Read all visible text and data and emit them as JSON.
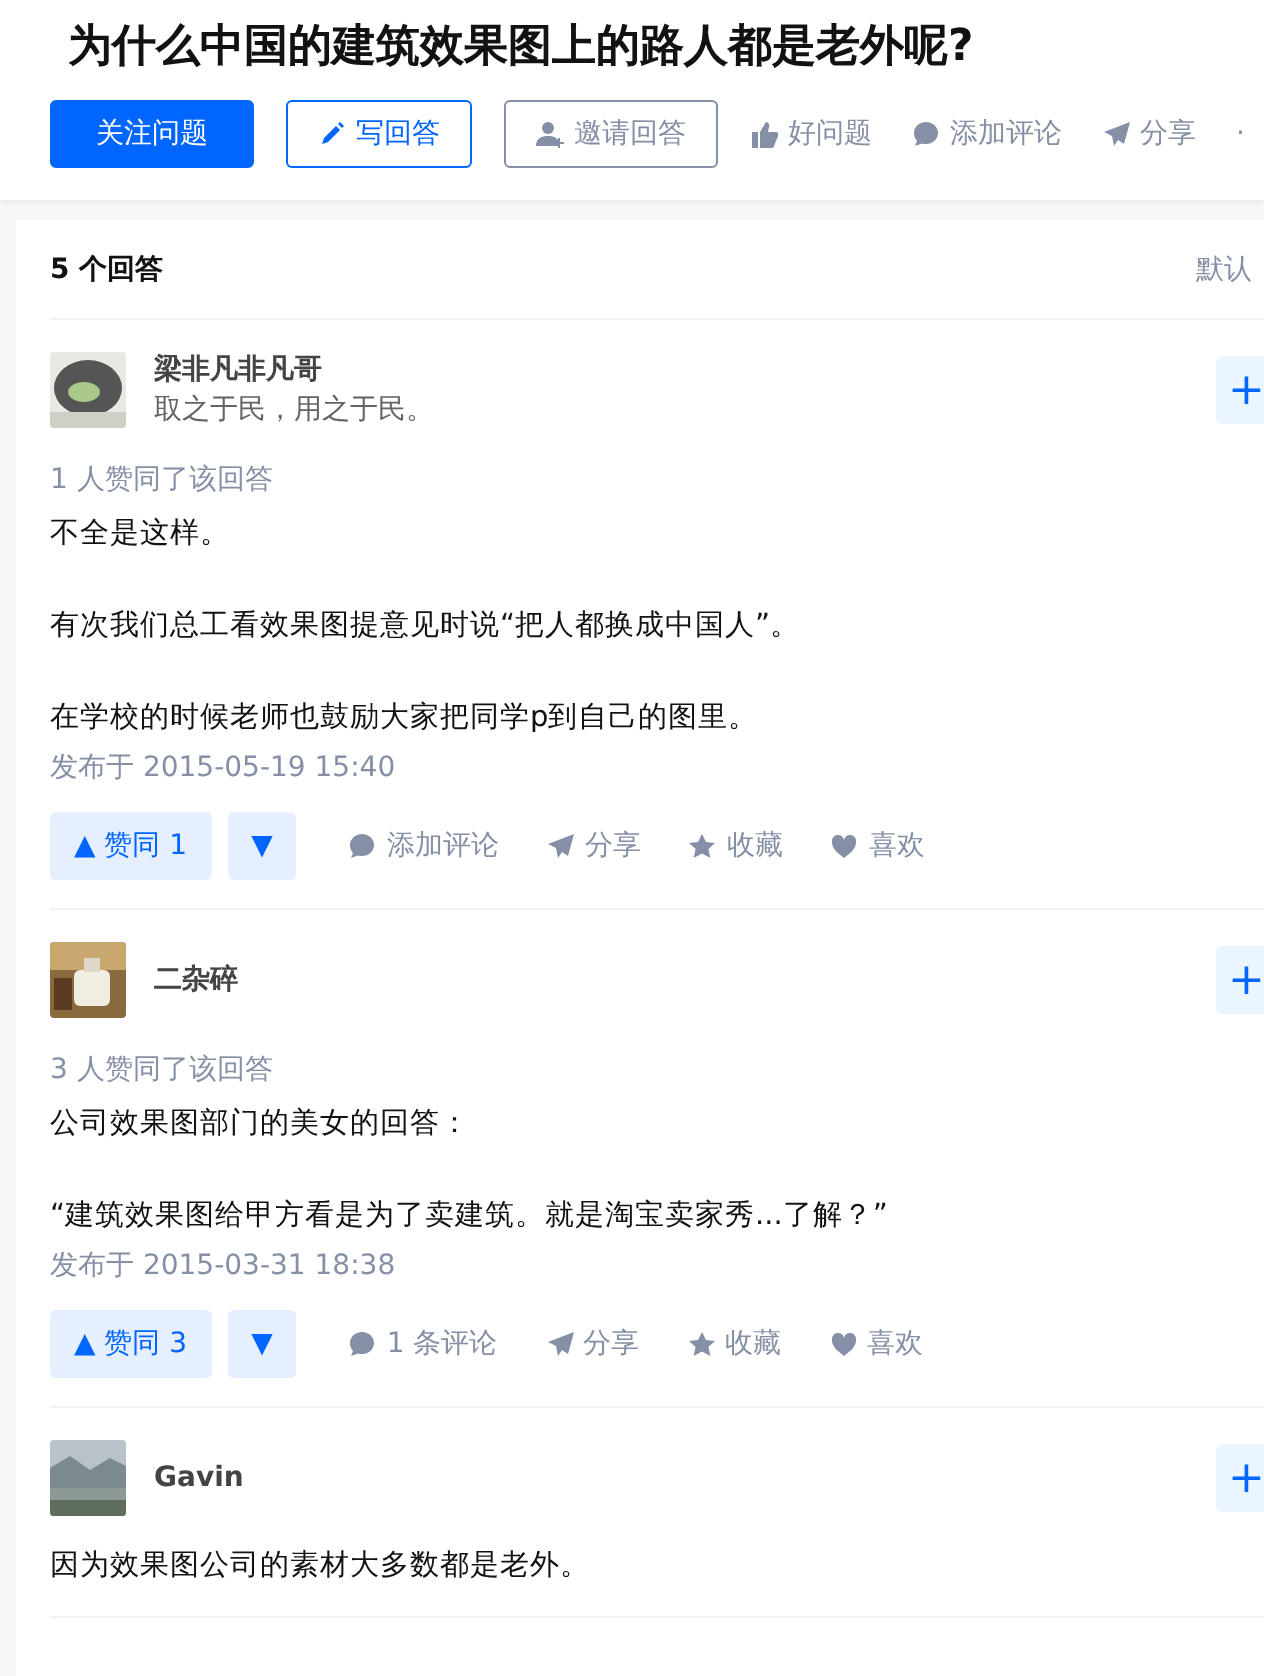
{
  "question": {
    "title": "为什么中国的建筑效果图上的路人都是老外呢?"
  },
  "toolbar": [
    {
      "kind": "primary",
      "label": "关注问题"
    },
    {
      "kind": "outline",
      "label": "写回答"
    },
    {
      "kind": "outline-grey",
      "label": "邀请回答"
    },
    {
      "kind": "plain",
      "label": "好问题"
    },
    {
      "kind": "plain",
      "label": "添加评论"
    },
    {
      "kind": "plain",
      "label": "分享"
    },
    {
      "kind": "plain",
      "label": "·"
    }
  ],
  "answers_header": {
    "count": "5 个回答",
    "sort": "默认"
  },
  "answers": [
    {
      "author": "梁非凡非凡哥",
      "bio": "取之于民，用之于民。",
      "follow": "+",
      "votes_note": "1 人赞同了该回答",
      "paragraphs": [
        "不全是这样。",
        "有次我们总工看效果图提意见时说“把人都换成中国人”。",
        "在学校的时候老师也鼓励大家把同学p到自己的图里。"
      ],
      "date": "发布于 2015-05-19 15:40",
      "actions": {
        "upvote": "▲ 赞同 1",
        "downvote": "▼",
        "items": [
          {
            "label": "添加评论"
          },
          {
            "label": "分享"
          },
          {
            "label": "收藏"
          },
          {
            "label": "喜欢"
          }
        ]
      }
    },
    {
      "author": "二杂碎",
      "follow": "+",
      "votes_note": "3 人赞同了该回答",
      "paragraphs": [
        "公司效果图部门的美女的回答：",
        "“建筑效果图给甲方看是为了卖建筑。就是淘宝卖家秀...了解？”"
      ],
      "date": "发布于 2015-03-31 18:38",
      "actions": {
        "upvote": "▲ 赞同 3",
        "downvote": "▼",
        "items": [
          {
            "label": "1 条评论"
          },
          {
            "label": "分享"
          },
          {
            "label": "收藏"
          },
          {
            "label": "喜欢"
          }
        ]
      }
    },
    {
      "author": "Gavin",
      "follow": "+",
      "paragraphs": [
        "因为效果图公司的素材大多数都是老外。"
      ]
    }
  ]
}
